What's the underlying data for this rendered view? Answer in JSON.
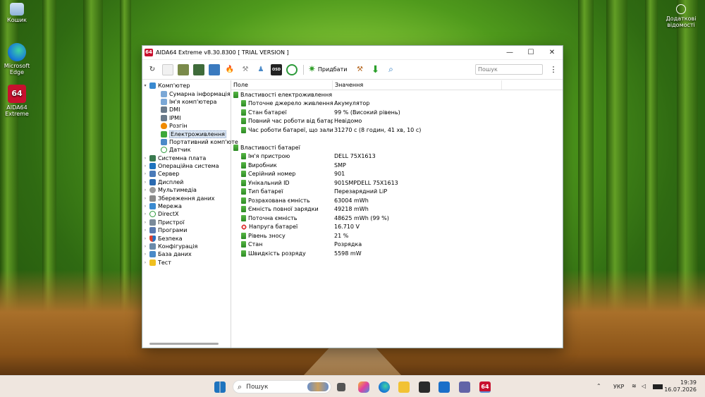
{
  "desktop": {
    "icons": [
      {
        "label": "Кошик"
      },
      {
        "label": "Microsoft Edge"
      },
      {
        "label": "AIDA64 Extreme"
      }
    ],
    "notice_label": "Додаткові відомості"
  },
  "window": {
    "title": "AIDA64 Extreme v8.30.8300  [ TRIAL VERSION ]",
    "logo_text": "64",
    "toolbar": {
      "add_label": "Придбати",
      "search_placeholder": "Пошук"
    },
    "tree": {
      "root": "Комп'ютер",
      "children": [
        "Сумарна інформація",
        "Ім'я комп'ютера",
        "DMI",
        "IPMI",
        "Розгін",
        "Електроживлення",
        "Портативний комп'юте",
        "Датчик"
      ],
      "groups": [
        "Системна плата",
        "Операційна система",
        "Сервер",
        "Дисплей",
        "Мультимедіа",
        "Збереження даних",
        "Мережа",
        "DirectX",
        "Пристрої",
        "Програми",
        "Безпека",
        "Конфігурація",
        "База даних",
        "Тест"
      ]
    },
    "columns": {
      "field": "Поле",
      "value": "Значення"
    },
    "sections": [
      {
        "title": "Властивості електроживлення",
        "rows": [
          {
            "field": "Поточне джерело живлення",
            "value": "Акумулятор"
          },
          {
            "field": "Стан батареї",
            "value": "99 % (Високий рівень)"
          },
          {
            "field": "Повний час роботи від батареї",
            "value": "Невідомо"
          },
          {
            "field": "Час роботи батареї, що залиш...",
            "value": "31270 с (8 годин, 41 хв, 10 с)"
          }
        ]
      },
      {
        "title": "Властивості батареї",
        "rows": [
          {
            "field": "Ім'я пристрою",
            "value": "DELL 75X1613"
          },
          {
            "field": "Виробник",
            "value": "SMP"
          },
          {
            "field": "Серійний номер",
            "value": "901"
          },
          {
            "field": "Унікальний ID",
            "value": "901SMPDELL 75X1613"
          },
          {
            "field": "Тип батареї",
            "value": "Перезарядний LiP"
          },
          {
            "field": "Розрахована ємність",
            "value": "63004 mWh"
          },
          {
            "field": "Ємність повної зарядки",
            "value": "49218 mWh"
          },
          {
            "field": "Поточна ємність",
            "value": "48625 mWh  (99 %)"
          },
          {
            "field": "Напруга батареї",
            "value": "16.710 V"
          },
          {
            "field": "Рівень зносу",
            "value": "21 %"
          },
          {
            "field": "Стан",
            "value": "Розрядка"
          },
          {
            "field": "Швидкість розряду",
            "value": "5598 mW"
          }
        ]
      }
    ]
  },
  "taskbar": {
    "search_label": "Пошук",
    "language": "УКР",
    "time": "19:39",
    "date": "16.07.2026",
    "app_badge": "64"
  }
}
